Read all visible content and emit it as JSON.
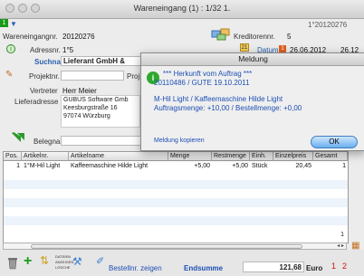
{
  "window": {
    "title": "Wareneingang (1) : 1/32 1."
  },
  "header": {
    "record_code": "1°20120276",
    "wareneingangnr_label": "Wareneingangnr.",
    "wareneingangnr_value": "20120276",
    "adressnr_label": "Adressnr.",
    "adressnr_value": "1°5",
    "suchname_label": "Suchname",
    "suchname_value": "Lieferant GmbH &",
    "projektnr_label": "Projektnr.",
    "proj_label": "Proj",
    "vertreter_label": "Vertreter",
    "vertreter_value": "Herr Meier",
    "lieferadresse_label": "Lieferadresse",
    "lieferadresse_lines": [
      "GUBUS Software Gmb",
      "Keesburgstraße 16",
      "97074 Würzburg"
    ],
    "belegname_label": "Belegname",
    "kreditorennr_label": "Kreditorennr.",
    "kreditorennr_value": "5",
    "datum_label": "Datum",
    "datum_value": "26.06.2012",
    "datum_extra": "26.12",
    "calendar_day": "21"
  },
  "dialog": {
    "title": "Meldung",
    "line1": "*** Herkunft vom Auftrag ***",
    "line2": "20110486 / GUTE  19.10.2011",
    "line3": "M-Hil Light / Kaffeemaschine Hilde Light",
    "line4": "Auftragsmenge: +10,00 / Bestellmenge: +0,00",
    "copy_link": "Meldung kopieren",
    "ok_label": "OK"
  },
  "table": {
    "columns": [
      "Pos.",
      "Artikelnr.",
      "Artikelname",
      "Menge",
      "Restmenge",
      "Einh.",
      "Einzelpreis",
      "Gesamt"
    ],
    "rows": [
      [
        "1",
        "1°M-Hil Light",
        "Kaffeemaschine Hilde Light",
        "+5,00",
        "+5,00",
        "Stück",
        "20,45",
        "1"
      ]
    ],
    "page_indicator": "1"
  },
  "footer": {
    "bestellnr_label": "Bestellnr. zeigen",
    "endsumme_label": "Endsumme",
    "endsumme_value": "121,68",
    "currency": "Euro",
    "tab1": "1",
    "tab2": "2",
    "small_label_1": "DATEIEN",
    "small_label_2": "ANZEIGEN",
    "small_label_3": "LÖSCHE"
  },
  "colors": {
    "accent_blue": "#1d4fb3",
    "status_green": "#1a9a1a",
    "red": "#d01010"
  }
}
